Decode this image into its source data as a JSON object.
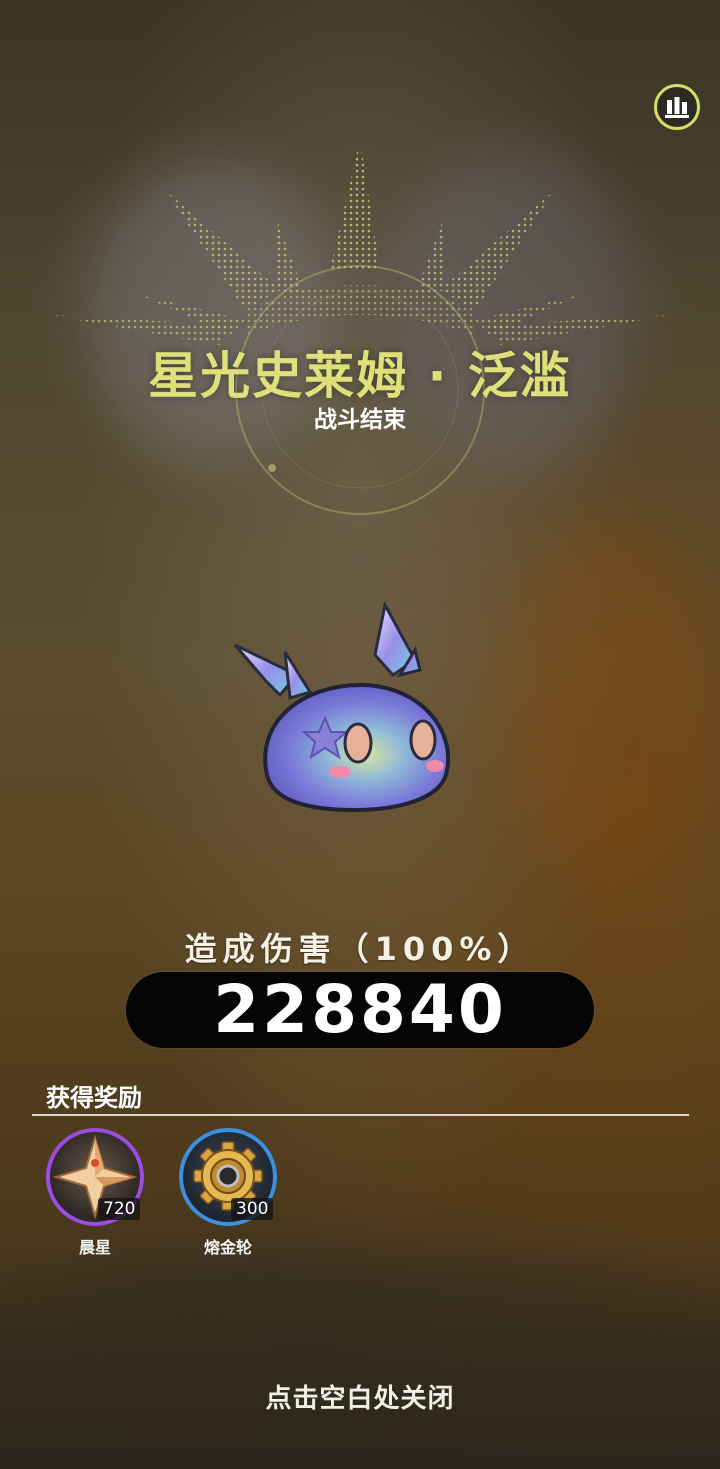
{
  "boss": {
    "name": "星光史莱姆 · 泛滥",
    "status": "战斗结束",
    "icon": "starlight-slime-icon"
  },
  "damage": {
    "label": "造成伤害（100%）",
    "value": "228840"
  },
  "rewards": {
    "title": "获得奖励",
    "items": [
      {
        "name": "晨星",
        "count": "720",
        "icon": "morning-star-icon",
        "ring_color": "#9b4de0"
      },
      {
        "name": "熔金轮",
        "count": "300",
        "icon": "molten-gold-wheel-icon",
        "ring_color": "#3d8fe0"
      }
    ]
  },
  "close_hint": "点击空白处关闭",
  "colors": {
    "title": "#dfe07a",
    "accent": "#d6dd6a",
    "damage_bar": "#050505"
  }
}
